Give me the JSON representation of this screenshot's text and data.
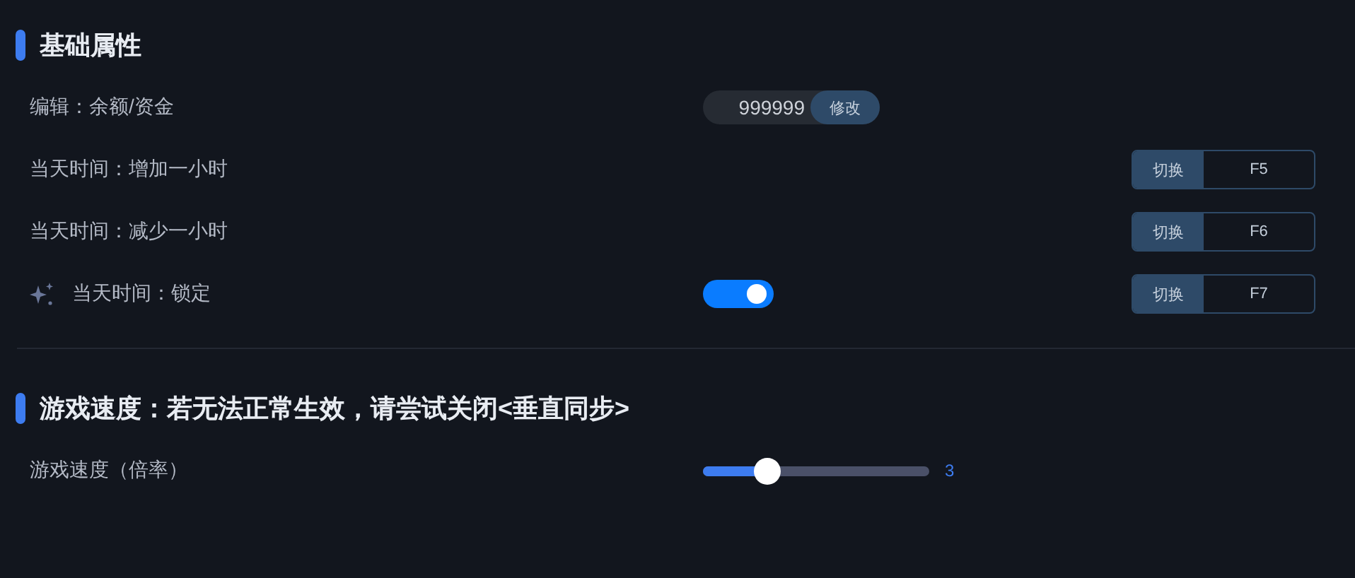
{
  "sections": [
    {
      "title": "基础属性",
      "rows": [
        {
          "kind": "input",
          "label": "编辑：余额/资金",
          "value": "999999",
          "button": "修改"
        },
        {
          "kind": "hotkey",
          "label": "当天时间：增加一小时",
          "hotkey": {
            "button": "切换",
            "key": "F5"
          }
        },
        {
          "kind": "hotkey",
          "label": "当天时间：减少一小时",
          "hotkey": {
            "button": "切换",
            "key": "F6"
          }
        },
        {
          "kind": "toggle",
          "label": "当天时间：锁定",
          "icon": true,
          "on": true,
          "hotkey": {
            "button": "切换",
            "key": "F7"
          }
        }
      ]
    },
    {
      "title": "游戏速度：若无法正常生效，请尝试关闭<垂直同步>",
      "rows": [
        {
          "kind": "slider",
          "label": "游戏速度（倍率）",
          "level": 0.29,
          "reading": "3"
        }
      ]
    }
  ]
}
